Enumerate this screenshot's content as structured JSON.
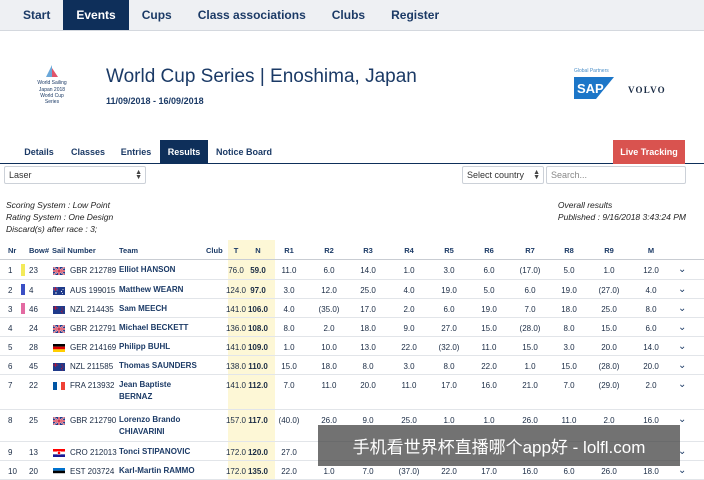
{
  "topnav": {
    "items": [
      "Start",
      "Events",
      "Cups",
      "Class associations",
      "Clubs",
      "Register"
    ],
    "active": "Events"
  },
  "header": {
    "logo_lines": [
      "World Sailing",
      "Japan 2018",
      "World Cup",
      "Series"
    ],
    "title": "World Cup Series | Enoshima, Japan",
    "dates": "11/09/2018 - 16/09/2018",
    "partner_label": "Global Partners",
    "sponsor_1": "SAP",
    "sponsor_2": "VOLVO"
  },
  "tabs": {
    "items": [
      "Details",
      "Classes",
      "Entries",
      "Results",
      "Notice Board"
    ],
    "active": "Results",
    "live_tracking": "Live Tracking"
  },
  "filters": {
    "class_value": "Laser",
    "country_placeholder": "Select country",
    "search_placeholder": "Search..."
  },
  "info": {
    "scoring": "Scoring System : Low Point",
    "rating": "Rating System : One Design",
    "discards": "Discard(s) after race : 3;",
    "overall": "Overall results",
    "published": "Published : 9/16/2018 3:43:24 PM"
  },
  "table": {
    "headers": [
      "Nr",
      "Bow#",
      "Sail Number",
      "Team",
      "Club",
      "T",
      "N",
      "R1",
      "R2",
      "R3",
      "R4",
      "R5",
      "R6",
      "R7",
      "R8",
      "R9",
      "M"
    ],
    "rows": [
      {
        "nr": "1",
        "bow": "23",
        "bar": "#f3ea5a",
        "flag": "gb",
        "sail": "GBR 212789",
        "team": "Elliot HANSON",
        "t": "76.0",
        "n": "59.0",
        "r": [
          "11.0",
          "6.0",
          "14.0",
          "1.0",
          "3.0",
          "6.0",
          "(17.0)",
          "5.0",
          "1.0"
        ],
        "m": "12.0"
      },
      {
        "nr": "2",
        "bow": "4",
        "bar": "#3b4fc4",
        "flag": "au",
        "sail": "AUS 199015",
        "team": "Matthew WEARN",
        "t": "124.0",
        "n": "97.0",
        "r": [
          "3.0",
          "12.0",
          "25.0",
          "4.0",
          "19.0",
          "5.0",
          "6.0",
          "19.0",
          "(27.0)"
        ],
        "m": "4.0"
      },
      {
        "nr": "3",
        "bow": "46",
        "bar": "#e36aa2",
        "flag": "nz",
        "sail": "NZL 214435",
        "team": "Sam MEECH",
        "t": "141.0",
        "n": "106.0",
        "r": [
          "4.0",
          "(35.0)",
          "17.0",
          "2.0",
          "6.0",
          "19.0",
          "7.0",
          "18.0",
          "25.0"
        ],
        "m": "8.0"
      },
      {
        "nr": "4",
        "bow": "24",
        "bar": "",
        "flag": "gb",
        "sail": "GBR 212791",
        "team": "Michael BECKETT",
        "t": "136.0",
        "n": "108.0",
        "r": [
          "8.0",
          "2.0",
          "18.0",
          "9.0",
          "27.0",
          "15.0",
          "(28.0)",
          "8.0",
          "15.0"
        ],
        "m": "6.0"
      },
      {
        "nr": "5",
        "bow": "28",
        "bar": "",
        "flag": "de",
        "sail": "GER 214169",
        "team": "Philipp BUHL",
        "t": "141.0",
        "n": "109.0",
        "r": [
          "1.0",
          "10.0",
          "13.0",
          "22.0",
          "(32.0)",
          "11.0",
          "15.0",
          "3.0",
          "20.0"
        ],
        "m": "14.0"
      },
      {
        "nr": "6",
        "bow": "45",
        "bar": "",
        "flag": "nz",
        "sail": "NZL 211585",
        "team": "Thomas SAUNDERS",
        "t": "138.0",
        "n": "110.0",
        "r": [
          "15.0",
          "18.0",
          "8.0",
          "3.0",
          "8.0",
          "22.0",
          "1.0",
          "15.0",
          "(28.0)"
        ],
        "m": "20.0"
      },
      {
        "nr": "7",
        "bow": "22",
        "bar": "",
        "flag": "fr",
        "sail": "FRA 213932",
        "team": "Jean Baptiste BERNAZ",
        "t": "141.0",
        "n": "112.0",
        "r": [
          "7.0",
          "11.0",
          "20.0",
          "11.0",
          "17.0",
          "16.0",
          "21.0",
          "7.0",
          "(29.0)"
        ],
        "m": "2.0"
      },
      {
        "nr": "8",
        "bow": "25",
        "bar": "",
        "flag": "gb",
        "sail": "GBR 212790",
        "team": "Lorenzo Brando CHIAVARINI",
        "t": "157.0",
        "n": "117.0",
        "r": [
          "(40.0)",
          "26.0",
          "9.0",
          "25.0",
          "1.0",
          "1.0",
          "26.0",
          "11.0",
          "2.0"
        ],
        "m": "16.0"
      },
      {
        "nr": "9",
        "bow": "13",
        "bar": "",
        "flag": "hr",
        "sail": "CRO 212013",
        "team": "Tonci STIPANOVIC",
        "t": "172.0",
        "n": "120.0",
        "r": [
          "27.0",
          "",
          "",
          "",
          "",
          "",
          "",
          "",
          ""
        ],
        "m": ""
      },
      {
        "nr": "10",
        "bow": "20",
        "bar": "",
        "flag": "ee",
        "sail": "EST 203724",
        "team": "Karl-Martin RAMMO",
        "t": "172.0",
        "n": "135.0",
        "r": [
          "22.0",
          "1.0",
          "7.0",
          "(37.0)",
          "22.0",
          "17.0",
          "16.0",
          "6.0",
          "26.0"
        ],
        "m": "18.0"
      }
    ]
  },
  "overlay_text": "手机看世界杯直播哪个app好 - lolfl.com"
}
